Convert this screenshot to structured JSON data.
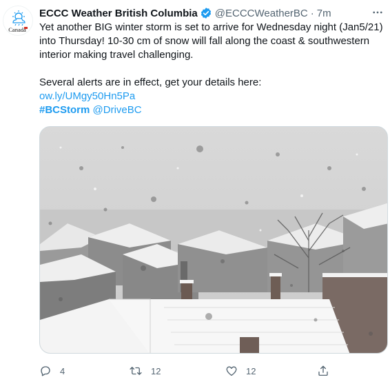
{
  "tweet": {
    "author_name": "ECCC Weather British Columbia",
    "handle": "@ECCCWeatherBC",
    "separator": "·",
    "time": "7m",
    "avatar_label": "Canada",
    "text_line1": "Yet another BIG winter storm is set to arrive for Wednesday night (Jan5/21)",
    "text_line2": "into Thursday! 10-30 cm of snow will fall along the coast & southwestern",
    "text_line3": "interior making travel challenging.",
    "alerts_text": "Several alerts are in effect, get your details here:",
    "link": "ow.ly/UMgy50Hn5Pa",
    "hashtag": "#BCStorm",
    "mention": "@DriveBC",
    "media_alt": "Snow falling over snow-covered rooftops"
  },
  "actions": {
    "reply_count": "4",
    "retweet_count": "12",
    "like_count": "12"
  },
  "colors": {
    "accent": "#1d9bf0",
    "muted": "#536471",
    "text": "#0f1419"
  },
  "icons": [
    "canada-logo-icon",
    "verified-badge-icon",
    "more-options-icon",
    "reply-icon",
    "retweet-icon",
    "like-icon",
    "share-icon"
  ]
}
